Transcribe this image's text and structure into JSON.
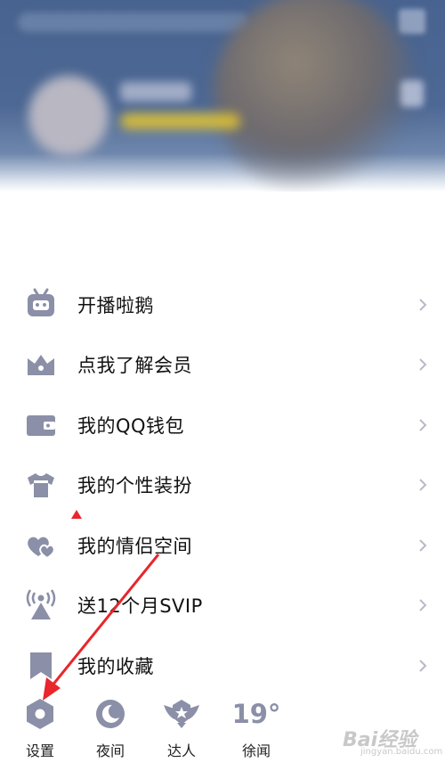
{
  "menu": {
    "items": [
      {
        "label": "开播啦鹅",
        "icon": "tv-robot-icon"
      },
      {
        "label": "点我了解会员",
        "icon": "crown-icon"
      },
      {
        "label": "我的QQ钱包",
        "icon": "wallet-icon"
      },
      {
        "label": "我的个性装扮",
        "icon": "tshirt-icon"
      },
      {
        "label": "我的情侣空间",
        "icon": "hearts-icon"
      },
      {
        "label": "送12个月SVIP",
        "icon": "broadcast-tower-icon"
      },
      {
        "label": "我的收藏",
        "icon": "bookmark-icon"
      }
    ]
  },
  "toolbar": {
    "settings_label": "设置",
    "night_label": "夜间",
    "expert_label": "达人",
    "weather_temp": "19°",
    "weather_city": "徐闻"
  },
  "colors": {
    "icon": "#8b8fa7",
    "header": "#4d6894",
    "arrow": "#e8262c"
  },
  "watermark": {
    "text": "Bai经验",
    "sub": "jingyan.baidu.com"
  }
}
